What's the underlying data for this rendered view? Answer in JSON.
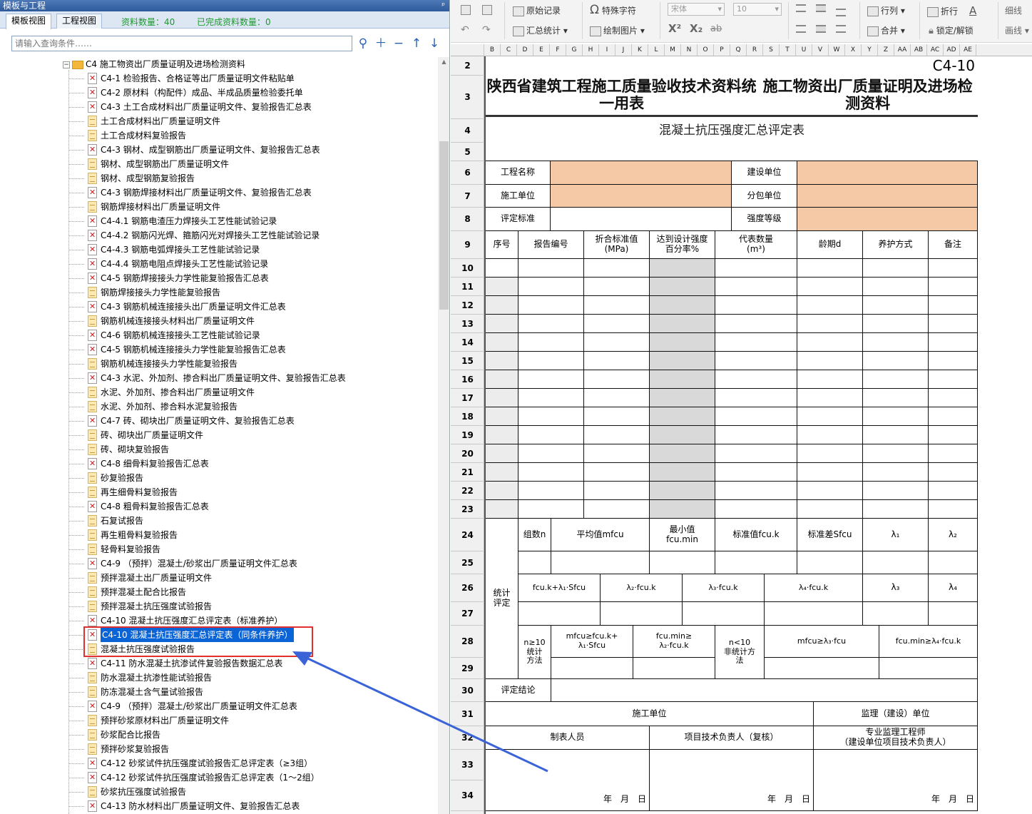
{
  "left_panel": {
    "title": "模板与工程",
    "pin": "ᵖ",
    "tabs": [
      "模板视图",
      "工程视图"
    ],
    "material_count": "资料数量：40",
    "completed_count": "已完成资料数量：0",
    "search_placeholder": "请输入查询条件……",
    "root_label": "C4 施工物资出厂质量证明及进场检测资料",
    "items": [
      {
        "icon": "red",
        "label": "C4-1 检验报告、合格证等出厂质量证明文件粘贴单"
      },
      {
        "icon": "red",
        "label": "C4-2 原材料（构配件）成品、半成品质量检验委托单"
      },
      {
        "icon": "red",
        "label": "C4-3 土工合成材料出厂质量证明文件、复验报告汇总表"
      },
      {
        "icon": "doc",
        "label": "土工合成材料出厂质量证明文件"
      },
      {
        "icon": "doc",
        "label": "土工合成材料复验报告"
      },
      {
        "icon": "red",
        "label": "C4-3 钢材、成型钢筋出厂质量证明文件、复验报告汇总表"
      },
      {
        "icon": "doc",
        "label": "钢材、成型钢筋出厂质量证明文件"
      },
      {
        "icon": "doc",
        "label": "钢材、成型钢筋复验报告"
      },
      {
        "icon": "red",
        "label": "C4-3 钢筋焊接材料出厂质量证明文件、复验报告汇总表"
      },
      {
        "icon": "doc",
        "label": "钢筋焊接材料出厂质量证明文件"
      },
      {
        "icon": "red",
        "label": "C4-4.1 钢筋电渣压力焊接头工艺性能试验记录"
      },
      {
        "icon": "red",
        "label": "C4-4.2 钢筋闪光焊、箍筋闪光对焊接头工艺性能试验记录"
      },
      {
        "icon": "red",
        "label": "C4-4.3 钢筋电弧焊接头工艺性能试验记录"
      },
      {
        "icon": "red",
        "label": "C4-4.4 钢筋电阻点焊接头工艺性能试验记录"
      },
      {
        "icon": "red",
        "label": "C4-5 钢筋焊接接头力学性能复验报告汇总表"
      },
      {
        "icon": "doc",
        "label": "钢筋焊接接头力学性能复验报告"
      },
      {
        "icon": "red",
        "label": "C4-3 钢筋机械连接接头出厂质量证明文件汇总表"
      },
      {
        "icon": "doc",
        "label": "钢筋机械连接接头材料出厂质量证明文件"
      },
      {
        "icon": "red",
        "label": "C4-6 钢筋机械连接接头工艺性能试验记录"
      },
      {
        "icon": "red",
        "label": "C4-5 钢筋机械连接接头力学性能复验报告汇总表"
      },
      {
        "icon": "doc",
        "label": "钢筋机械连接接头力学性能复验报告"
      },
      {
        "icon": "red",
        "label": "C4-3 水泥、外加剂、掺合料出厂质量证明文件、复验报告汇总表"
      },
      {
        "icon": "doc",
        "label": "水泥、外加剂、掺合料出厂质量证明文件"
      },
      {
        "icon": "doc",
        "label": "水泥、外加剂、掺合料水泥复验报告"
      },
      {
        "icon": "red",
        "label": "C4-7 砖、砌块出厂质量证明文件、复验报告汇总表"
      },
      {
        "icon": "doc",
        "label": "砖、砌块出厂质量证明文件"
      },
      {
        "icon": "doc",
        "label": "砖、砌块复验报告"
      },
      {
        "icon": "red",
        "label": "C4-8 细骨料复验报告汇总表"
      },
      {
        "icon": "doc",
        "label": "砂复验报告"
      },
      {
        "icon": "doc",
        "label": "再生细骨料复验报告"
      },
      {
        "icon": "red",
        "label": "C4-8 粗骨料复验报告汇总表"
      },
      {
        "icon": "doc",
        "label": "石复试报告"
      },
      {
        "icon": "doc",
        "label": "再生粗骨料复验报告"
      },
      {
        "icon": "doc",
        "label": "轻骨料复验报告"
      },
      {
        "icon": "red",
        "label": "C4-9 （预拌）混凝土/砂浆出厂质量证明文件汇总表"
      },
      {
        "icon": "doc",
        "label": "预拌混凝土出厂质量证明文件"
      },
      {
        "icon": "doc",
        "label": "预拌混凝土配合比报告"
      },
      {
        "icon": "doc",
        "label": "预拌混凝土抗压强度试验报告"
      },
      {
        "icon": "red",
        "label": "C4-10 混凝土抗压强度汇总评定表（标准养护）"
      },
      {
        "icon": "red",
        "label": "C4-10 混凝土抗压强度汇总评定表（同条件养护）",
        "selected": true
      },
      {
        "icon": "doc",
        "label": "混凝土抗压强度试验报告"
      },
      {
        "icon": "red",
        "label": "C4-11 防水混凝土抗渗试件复验报告数据汇总表"
      },
      {
        "icon": "doc",
        "label": "防水混凝土抗渗性能试验报告"
      },
      {
        "icon": "doc",
        "label": "防冻混凝土含气量试验报告"
      },
      {
        "icon": "red",
        "label": "C4-9 （预拌）混凝土/砂浆出厂质量证明文件汇总表"
      },
      {
        "icon": "doc",
        "label": "预拌砂浆原材料出厂质量证明文件"
      },
      {
        "icon": "doc",
        "label": "砂浆配合比报告"
      },
      {
        "icon": "doc",
        "label": "预拌砂浆复验报告"
      },
      {
        "icon": "red",
        "label": "C4-12 砂浆试件抗压强度试验报告汇总评定表（≥3组）"
      },
      {
        "icon": "red",
        "label": "C4-12 砂浆试件抗压强度试验报告汇总评定表（1～2组）"
      },
      {
        "icon": "doc",
        "label": "砂浆抗压强度试验报告"
      },
      {
        "icon": "red",
        "label": "C4-13 防水材料出厂质量证明文件、复验报告汇总表"
      }
    ]
  },
  "toolbar": {
    "raw_record": "原始记录",
    "summary": "汇总统计 ▾",
    "special_char": "特殊字符",
    "draw_image": "绘制图片 ▾",
    "font": "宋体",
    "font_size": "10",
    "sup": "X²",
    "sub": "X₂",
    "strike": "ab",
    "row_col": "行列 ▾",
    "merge": "合并 ▾",
    "wrap": "折行",
    "lock": "锁定/解锁",
    "thin_line": "细线",
    "draw_line": "画线 ▾"
  },
  "columns": [
    "B",
    "C",
    "D",
    "E",
    "F",
    "G",
    "H",
    "I",
    "J",
    "K",
    "L",
    "M",
    "N",
    "O",
    "P",
    "Q",
    "R",
    "S",
    "T",
    "U",
    "V",
    "W",
    "X",
    "Y",
    "Z",
    "AA",
    "AB",
    "AC",
    "AD",
    "AE"
  ],
  "row_numbers": [
    "2",
    "3",
    "4",
    "5",
    "6",
    "7",
    "8",
    "9",
    "10",
    "11",
    "12",
    "13",
    "14",
    "15",
    "16",
    "17",
    "18",
    "19",
    "20",
    "21",
    "22",
    "23",
    "24",
    "25",
    "26",
    "27",
    "28",
    "29",
    "30",
    "31",
    "32",
    "33",
    "34"
  ],
  "form": {
    "code": "C4-10",
    "title_line1": "陕西省建筑工程施工质量验收技术资料统一用表",
    "title_line2": "施工物资出厂质量证明及进场检测资料",
    "subtitle": "混凝土抗压强度汇总评定表",
    "project_name": "工程名称",
    "builder": "建设单位",
    "construction_unit": "施工单位",
    "subcontractor": "分包单位",
    "standard": "评定标准",
    "strength_grade": "强度等级",
    "h_seq": "序号",
    "h_report": "报告编号",
    "h_std": "折合标准值\n(MPa)",
    "h_pct": "达到设计强度\n百分率%",
    "h_qty": "代表数量\n(m³)",
    "h_age": "龄期d",
    "h_cure": "养护方式",
    "h_note": "备注",
    "stat_eval": "统计\n评定",
    "groups_n": "组数n",
    "mean": "平均值mfcu",
    "min": "最小值\nfcu.min",
    "std_val": "标准值fcu.k",
    "std_dev": "标准差Sfcu",
    "lambda1": "λ₁",
    "lambda2": "λ₂",
    "f1": "fcu.k+λ₁·Sfcu",
    "f2": "λ₂·fcu.k",
    "f3": "λ₃·fcu.k",
    "f4": "λ₄·fcu.k",
    "lambda3": "λ₃",
    "lambda4": "λ₄",
    "n10_stat": "n≥10\n统计\n方法",
    "cond1": "mfcu≥fcu.k+\nλ₁·Sfcu",
    "cond2": "fcu.min≥\nλ₂·fcu.k",
    "n10_nonstat": "n<10\n非统计方\n法",
    "cond3": "mfcu≥λ₃·fcu",
    "cond4": "fcu.min≥λ₄·fcu.k",
    "conclusion": "评定结论",
    "construction_unit2": "施工单位",
    "supervision": "监理（建设）单位",
    "preparer": "制表人员",
    "tech_lead": "项目技术负责人（复核）",
    "engineer": "专业监理工程师\n（建设单位项目技术负责人）",
    "date": "年　月　日"
  }
}
